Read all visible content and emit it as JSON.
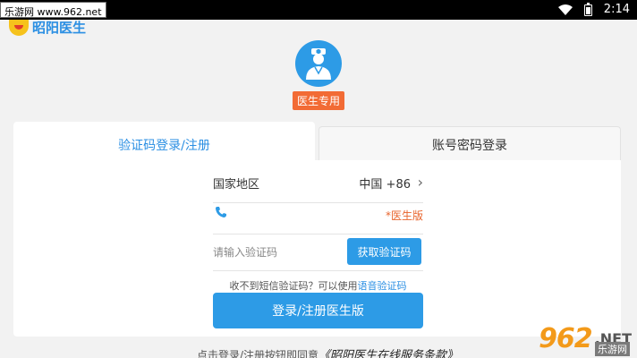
{
  "status_bar": {
    "time": "2:14"
  },
  "watermark_top": {
    "text": "乐游网 www.962.net"
  },
  "app": {
    "name": "昭阳医生"
  },
  "header": {
    "badge": "医生专用"
  },
  "tabs": [
    {
      "label": "验证码登录/注册",
      "active": true
    },
    {
      "label": "账号密码登录",
      "active": false
    }
  ],
  "form": {
    "region_label": "国家地区",
    "region_value": "中国 +86",
    "phone_tag": "*医生版",
    "code_placeholder": "请输入验证码",
    "get_code_label": "获取验证码",
    "hint_prefix": "收不到短信验证码？可以使用",
    "hint_link": "语音验证码",
    "submit_label": "登录/注册医生版"
  },
  "footer": {
    "agree_prefix": "点击登录/注册按钮即同意",
    "agree_link": "《昭阳医生在线服务条款》"
  },
  "watermark_bottom": {
    "nums": "962",
    "net": ".NET",
    "cn": "乐游网"
  },
  "colors": {
    "accent": "#2d9be6",
    "badge": "#f26b35",
    "tag": "#e8642c"
  }
}
